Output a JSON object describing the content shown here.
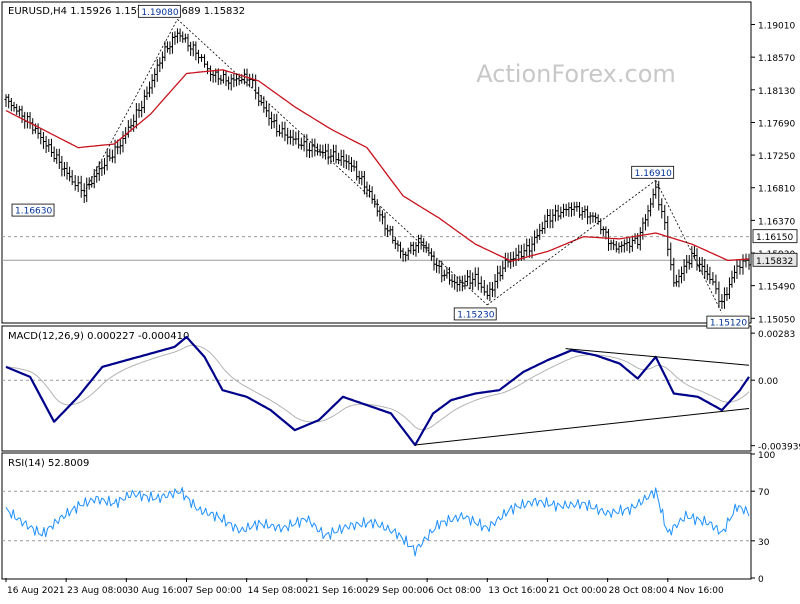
{
  "colors": {
    "price": "#000000",
    "ma": "#c8141e",
    "macd": "#00008b",
    "signal": "#b4b4b4",
    "rsi": "#1e90ff",
    "grid": "#9a9a9a",
    "label_bg": "#ffffff",
    "label_text": "#003399",
    "watermark": "#c8c8c8"
  },
  "chart_data": {
    "type": "line",
    "title": "EURUSD,H4 1.15926 1.15978 1.15689 1.15832",
    "watermark": "ActionForex.com",
    "x_labels": [
      "16 Aug 2021",
      "23 Aug 08:00",
      "30 Aug 16:00",
      "7 Sep 00:00",
      "14 Sep 08:00",
      "21 Sep 16:00",
      "29 Sep 00:00",
      "6 Oct 08:00",
      "13 Oct 16:00",
      "21 Oct 00:00",
      "28 Oct 08:00",
      "4 Nov 16:00"
    ],
    "price_panel": {
      "ylim": [
        1.15,
        1.193
      ],
      "ticks": [
        "1.19010",
        "1.18570",
        "1.18130",
        "1.17690",
        "1.17250",
        "1.16810",
        "1.16370",
        "1.15930",
        "1.15490",
        "1.15050"
      ],
      "level_lines": [
        {
          "value": 1.1615,
          "label": "1.16150",
          "style": "dashed"
        },
        {
          "value": 1.15832,
          "label": "1.15832",
          "style": "solid"
        }
      ],
      "annotations": [
        {
          "label": "1.16630",
          "x": 0.04,
          "y": 1.1663
        },
        {
          "label": "1.19080",
          "x": 0.23,
          "y": 1.1908
        },
        {
          "label": "1.15230",
          "x": 0.68,
          "y": 1.1523
        },
        {
          "label": "1.16910",
          "x": 0.88,
          "y": 1.1691
        },
        {
          "label": "1.15120",
          "x": 0.95,
          "y": 1.1512
        }
      ],
      "close_keypoints": [
        {
          "x": 0.0,
          "y": 1.18
        },
        {
          "x": 0.4,
          "y": 1.1768
        },
        {
          "x": 0.8,
          "y": 1.1725
        },
        {
          "x": 1.1,
          "y": 1.169
        },
        {
          "x": 1.3,
          "y": 1.1675
        },
        {
          "x": 1.55,
          "y": 1.1705
        },
        {
          "x": 1.9,
          "y": 1.174
        },
        {
          "x": 2.3,
          "y": 1.18
        },
        {
          "x": 2.6,
          "y": 1.186
        },
        {
          "x": 2.85,
          "y": 1.189
        },
        {
          "x": 3.2,
          "y": 1.186
        },
        {
          "x": 3.4,
          "y": 1.1835
        },
        {
          "x": 3.7,
          "y": 1.1825
        },
        {
          "x": 4.05,
          "y": 1.183
        },
        {
          "x": 4.2,
          "y": 1.18
        },
        {
          "x": 4.5,
          "y": 1.176
        },
        {
          "x": 5.0,
          "y": 1.1735
        },
        {
          "x": 5.4,
          "y": 1.1725
        },
        {
          "x": 5.7,
          "y": 1.1715
        },
        {
          "x": 6.0,
          "y": 1.168
        },
        {
          "x": 6.3,
          "y": 1.163
        },
        {
          "x": 6.6,
          "y": 1.159
        },
        {
          "x": 6.9,
          "y": 1.161
        },
        {
          "x": 7.2,
          "y": 1.157
        },
        {
          "x": 7.5,
          "y": 1.155
        },
        {
          "x": 7.8,
          "y": 1.156
        },
        {
          "x": 8.0,
          "y": 1.1535
        },
        {
          "x": 8.3,
          "y": 1.158
        },
        {
          "x": 8.7,
          "y": 1.16
        },
        {
          "x": 9.0,
          "y": 1.164
        },
        {
          "x": 9.4,
          "y": 1.1655
        },
        {
          "x": 9.8,
          "y": 1.164
        },
        {
          "x": 10.1,
          "y": 1.16
        },
        {
          "x": 10.5,
          "y": 1.161
        },
        {
          "x": 10.8,
          "y": 1.168
        },
        {
          "x": 10.95,
          "y": 1.163
        },
        {
          "x": 11.1,
          "y": 1.155
        },
        {
          "x": 11.4,
          "y": 1.159
        },
        {
          "x": 11.7,
          "y": 1.156
        },
        {
          "x": 11.9,
          "y": 1.1525
        },
        {
          "x": 12.15,
          "y": 1.1575
        },
        {
          "x": 12.35,
          "y": 1.1583
        }
      ],
      "ma_keypoints": [
        {
          "x": 0.0,
          "y": 1.1785
        },
        {
          "x": 0.6,
          "y": 1.176
        },
        {
          "x": 1.2,
          "y": 1.1735
        },
        {
          "x": 1.8,
          "y": 1.174
        },
        {
          "x": 2.4,
          "y": 1.178
        },
        {
          "x": 3.0,
          "y": 1.1835
        },
        {
          "x": 3.6,
          "y": 1.184
        },
        {
          "x": 4.2,
          "y": 1.1825
        },
        {
          "x": 4.8,
          "y": 1.179
        },
        {
          "x": 5.4,
          "y": 1.176
        },
        {
          "x": 6.0,
          "y": 1.1735
        },
        {
          "x": 6.6,
          "y": 1.167
        },
        {
          "x": 7.2,
          "y": 1.164
        },
        {
          "x": 7.8,
          "y": 1.1605
        },
        {
          "x": 8.4,
          "y": 1.1582
        },
        {
          "x": 9.0,
          "y": 1.1595
        },
        {
          "x": 9.6,
          "y": 1.1615
        },
        {
          "x": 10.2,
          "y": 1.1612
        },
        {
          "x": 10.8,
          "y": 1.162
        },
        {
          "x": 11.4,
          "y": 1.1605
        },
        {
          "x": 12.0,
          "y": 1.1583
        },
        {
          "x": 12.35,
          "y": 1.1585
        }
      ]
    },
    "macd_panel": {
      "label": "MACD(12,26,9) 0.000227 -0.000410",
      "ylim": [
        -0.0042,
        0.0032
      ],
      "ticks": [
        "0.00283",
        "0.00",
        "-0.003939"
      ],
      "zero_line": 0,
      "macd_keypoints": [
        {
          "x": 0.0,
          "y": 0.0008
        },
        {
          "x": 0.4,
          "y": 0.0002
        },
        {
          "x": 0.8,
          "y": -0.0025
        },
        {
          "x": 1.2,
          "y": -0.001
        },
        {
          "x": 1.6,
          "y": 0.0008
        },
        {
          "x": 2.0,
          "y": 0.0012
        },
        {
          "x": 2.4,
          "y": 0.0016
        },
        {
          "x": 2.8,
          "y": 0.002
        },
        {
          "x": 3.0,
          "y": 0.0026
        },
        {
          "x": 3.3,
          "y": 0.0014
        },
        {
          "x": 3.6,
          "y": -0.0006
        },
        {
          "x": 4.0,
          "y": -0.001
        },
        {
          "x": 4.4,
          "y": -0.0018
        },
        {
          "x": 4.8,
          "y": -0.003
        },
        {
          "x": 5.2,
          "y": -0.0024
        },
        {
          "x": 5.6,
          "y": -0.001
        },
        {
          "x": 6.0,
          "y": -0.0015
        },
        {
          "x": 6.4,
          "y": -0.002
        },
        {
          "x": 6.8,
          "y": -0.0039
        },
        {
          "x": 7.1,
          "y": -0.002
        },
        {
          "x": 7.4,
          "y": -0.0012
        },
        {
          "x": 7.8,
          "y": -0.0008
        },
        {
          "x": 8.2,
          "y": -0.0006
        },
        {
          "x": 8.6,
          "y": 0.0005
        },
        {
          "x": 9.0,
          "y": 0.0012
        },
        {
          "x": 9.4,
          "y": 0.0018
        },
        {
          "x": 9.8,
          "y": 0.0015
        },
        {
          "x": 10.2,
          "y": 0.001
        },
        {
          "x": 10.5,
          "y": 0.0001
        },
        {
          "x": 10.8,
          "y": 0.0014
        },
        {
          "x": 11.1,
          "y": -0.0008
        },
        {
          "x": 11.5,
          "y": -0.001
        },
        {
          "x": 11.9,
          "y": -0.0018
        },
        {
          "x": 12.2,
          "y": -0.0006
        },
        {
          "x": 12.35,
          "y": 0.0002
        }
      ],
      "trendlines": [
        {
          "from": {
            "x": 9.3,
            "y": 0.0019
          },
          "to": {
            "x": 12.35,
            "y": 0.0009
          }
        },
        {
          "from": {
            "x": 6.8,
            "y": -0.0039
          },
          "to": {
            "x": 12.35,
            "y": -0.0017
          }
        }
      ]
    },
    "rsi_panel": {
      "label": "RSI(14) 52.8009",
      "ylim": [
        0,
        100
      ],
      "ticks": [
        "100",
        "70",
        "30",
        "0"
      ],
      "dashed_levels": [
        70,
        30
      ],
      "rsi_keypoints": [
        {
          "x": 0.0,
          "y": 55
        },
        {
          "x": 0.3,
          "y": 44
        },
        {
          "x": 0.6,
          "y": 35
        },
        {
          "x": 0.9,
          "y": 48
        },
        {
          "x": 1.2,
          "y": 58
        },
        {
          "x": 1.5,
          "y": 64
        },
        {
          "x": 1.8,
          "y": 60
        },
        {
          "x": 2.1,
          "y": 68
        },
        {
          "x": 2.5,
          "y": 64
        },
        {
          "x": 2.9,
          "y": 70
        },
        {
          "x": 3.2,
          "y": 55
        },
        {
          "x": 3.5,
          "y": 50
        },
        {
          "x": 3.9,
          "y": 38
        },
        {
          "x": 4.2,
          "y": 44
        },
        {
          "x": 4.6,
          "y": 40
        },
        {
          "x": 5.0,
          "y": 48
        },
        {
          "x": 5.3,
          "y": 34
        },
        {
          "x": 5.7,
          "y": 42
        },
        {
          "x": 6.1,
          "y": 45
        },
        {
          "x": 6.5,
          "y": 36
        },
        {
          "x": 6.8,
          "y": 22
        },
        {
          "x": 7.2,
          "y": 44
        },
        {
          "x": 7.6,
          "y": 50
        },
        {
          "x": 8.0,
          "y": 40
        },
        {
          "x": 8.4,
          "y": 56
        },
        {
          "x": 8.8,
          "y": 62
        },
        {
          "x": 9.2,
          "y": 58
        },
        {
          "x": 9.6,
          "y": 60
        },
        {
          "x": 10.0,
          "y": 52
        },
        {
          "x": 10.4,
          "y": 56
        },
        {
          "x": 10.8,
          "y": 70
        },
        {
          "x": 11.0,
          "y": 36
        },
        {
          "x": 11.3,
          "y": 50
        },
        {
          "x": 11.7,
          "y": 44
        },
        {
          "x": 11.9,
          "y": 36
        },
        {
          "x": 12.15,
          "y": 58
        },
        {
          "x": 12.35,
          "y": 52.8
        }
      ]
    }
  }
}
